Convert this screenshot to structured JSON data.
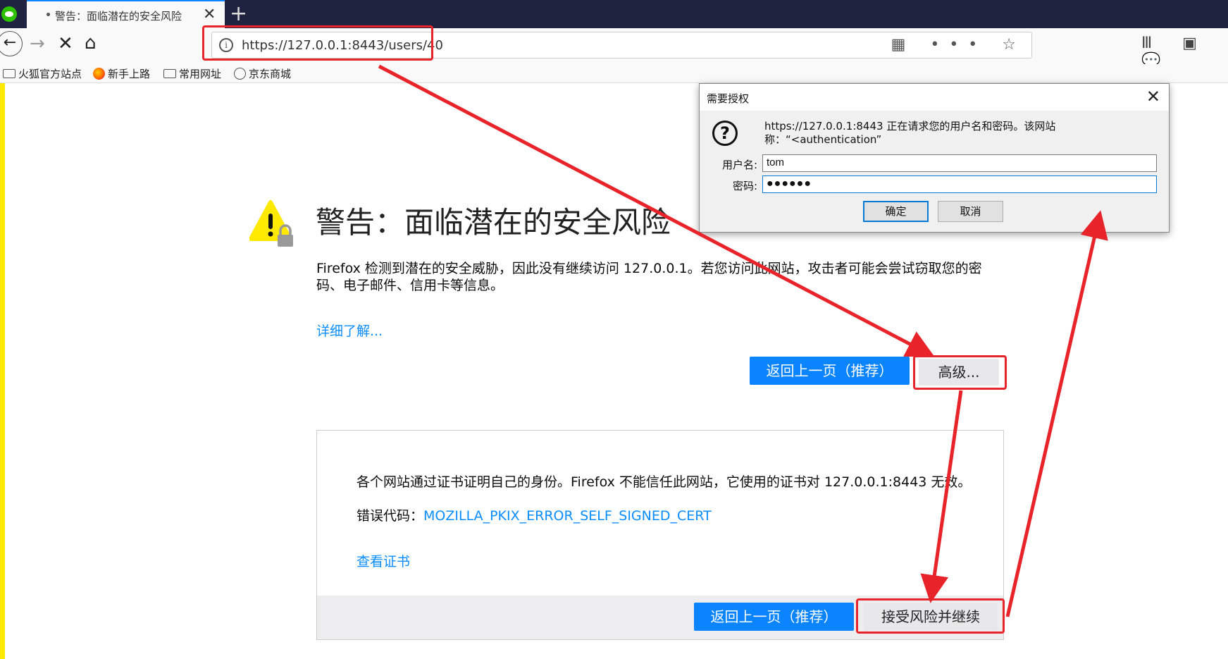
{
  "tab": {
    "title": "警告：面临潜在的安全风险",
    "close": "✕",
    "new_tab": "+"
  },
  "nav": {
    "url": "https://127.0.0.1:8443/users/40",
    "info_glyph": "i",
    "right_icons": "▦ ••• ☆",
    "toolbar_icons": "Ⅲ ▣ 💬"
  },
  "bookmarks": [
    {
      "label": "火狐官方站点",
      "icon": "folder-icon"
    },
    {
      "label": "新手上路",
      "icon": "firefox-icon"
    },
    {
      "label": "常用网址",
      "icon": "folder-icon"
    },
    {
      "label": "京东商城",
      "icon": "globe-icon"
    }
  ],
  "page": {
    "title": "警告：面临潜在的安全风险",
    "description": "Firefox 检测到潜在的安全威胁，因此没有继续访问 127.0.0.1。若您访问此网站，攻击者可能会尝试窃取您的密码、电子邮件、信用卡等信息。",
    "learn_more": "详细了解...",
    "back_button": "返回上一页（推荐）",
    "advanced_button": "高级...",
    "advanced": {
      "text": "各个网站通过证书证明自己的身份。Firefox 不能信任此网站，它使用的证书对 127.0.0.1:8443 无效。",
      "error_label": "错误代码：",
      "error_code": "MOZILLA_PKIX_ERROR_SELF_SIGNED_CERT",
      "view_cert": "查看证书",
      "back_button": "返回上一页（推荐）",
      "accept_button": "接受风险并继续"
    }
  },
  "auth_dialog": {
    "title": "需要授权",
    "close": "✕",
    "message": "https://127.0.0.1:8443 正在请求您的用户名和密码。该网站称：“<authentication”",
    "username_label": "用户名:",
    "username_value": "tom",
    "password_label": "密码:",
    "password_value": "●●●●●●",
    "ok_button": "确定",
    "cancel_button": "取消"
  },
  "colors": {
    "accent": "#0a84ff",
    "annotation": "#e8242a",
    "warning": "#ffe900"
  }
}
